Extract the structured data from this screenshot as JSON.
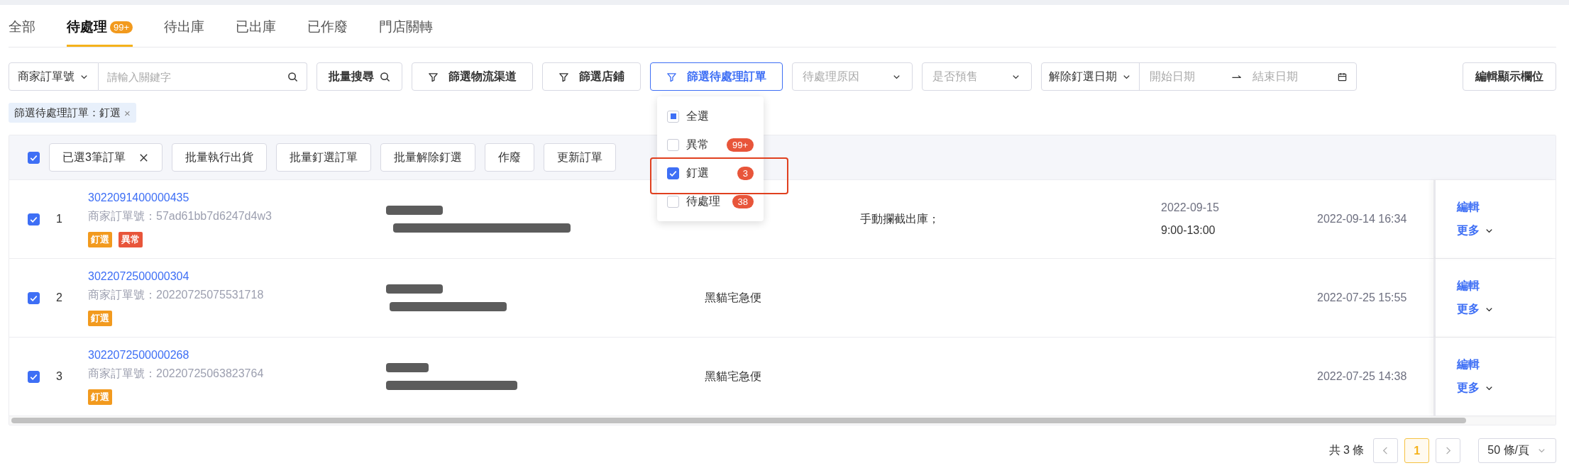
{
  "tabs": [
    {
      "label": "全部",
      "selected": false
    },
    {
      "label": "待處理",
      "badge": "99+",
      "selected": true
    },
    {
      "label": "待出庫",
      "selected": false
    },
    {
      "label": "已出庫",
      "selected": false
    },
    {
      "label": "已作廢",
      "selected": false
    },
    {
      "label": "門店關轉",
      "selected": false
    }
  ],
  "filter_bar": {
    "search_field": {
      "field_select": "商家訂單號",
      "placeholder": "請輸入關鍵字"
    },
    "batch_search": "批量搜尋",
    "filter_buttons": [
      {
        "label": "篩選物流渠道",
        "expanded": false
      },
      {
        "label": "篩選店鋪",
        "expanded": false
      },
      {
        "label": "篩選待處理訂單",
        "expanded": true
      }
    ],
    "selects": [
      {
        "placeholder": "待處理原因"
      },
      {
        "placeholder": "是否預售"
      }
    ],
    "date_range": {
      "field_select": "解除釘選日期",
      "start_placeholder": "開始日期",
      "end_placeholder": "結束日期"
    },
    "edit_columns": "編輯顯示欄位"
  },
  "filter_tags": [
    {
      "text": "篩選待處理訂單：釘選",
      "close": "×"
    }
  ],
  "dropdown": {
    "items": [
      {
        "label": "全選",
        "checked": false,
        "indeterminate": true,
        "highlighted": false
      },
      {
        "label": "異常",
        "badge": "99+",
        "checked": false,
        "indeterminate": false,
        "highlighted": false
      },
      {
        "label": "釘選",
        "badge": "3",
        "checked": true,
        "indeterminate": false,
        "highlighted": true
      },
      {
        "label": "待處理",
        "badge": "38",
        "checked": false,
        "indeterminate": false,
        "highlighted": false
      }
    ]
  },
  "bulk_bar": {
    "select_all_checked": true,
    "selection": "已選3筆訂單",
    "actions": [
      "批量執行出貨",
      "批量釘選訂單",
      "批量解除釘選",
      "作廢",
      "更新訂單"
    ]
  },
  "rows": [
    {
      "checked": true,
      "index": "1",
      "order_no": "3022091400000435",
      "merchant_no": "商家訂單號：57ad61bb7d6247d4w3",
      "tags": [
        {
          "text": "釘選",
          "color": "#f29a1e"
        },
        {
          "text": "異常",
          "color": "#e8553a"
        }
      ],
      "recipient_redacted": true,
      "note": "手動攔截出庫；",
      "delivery_date": "2022-09-15",
      "delivery_time": "9:00-13:00",
      "created": "2022-09-14 16:34",
      "edit": "編輯",
      "more": "更多"
    },
    {
      "checked": true,
      "index": "2",
      "order_no": "3022072500000304",
      "merchant_no": "商家訂單號：20220725075531718",
      "tags": [
        {
          "text": "釘選",
          "color": "#f29a1e"
        }
      ],
      "recipient_redacted": true,
      "carrier": "黑貓宅急便",
      "created": "2022-07-25 15:55",
      "edit": "編輯",
      "more": "更多"
    },
    {
      "checked": true,
      "index": "3",
      "order_no": "3022072500000268",
      "merchant_no": "商家訂單號：20220725063823764",
      "tags": [
        {
          "text": "釘選",
          "color": "#f29a1e"
        }
      ],
      "recipient_redacted": true,
      "carrier": "黑貓宅急便",
      "created": "2022-07-25 14:38",
      "edit": "編輯",
      "more": "更多"
    }
  ],
  "pagination": {
    "total": "共 3 條",
    "pages": [
      {
        "label": "1",
        "selected": true
      }
    ],
    "page_size": "50 條/頁"
  }
}
